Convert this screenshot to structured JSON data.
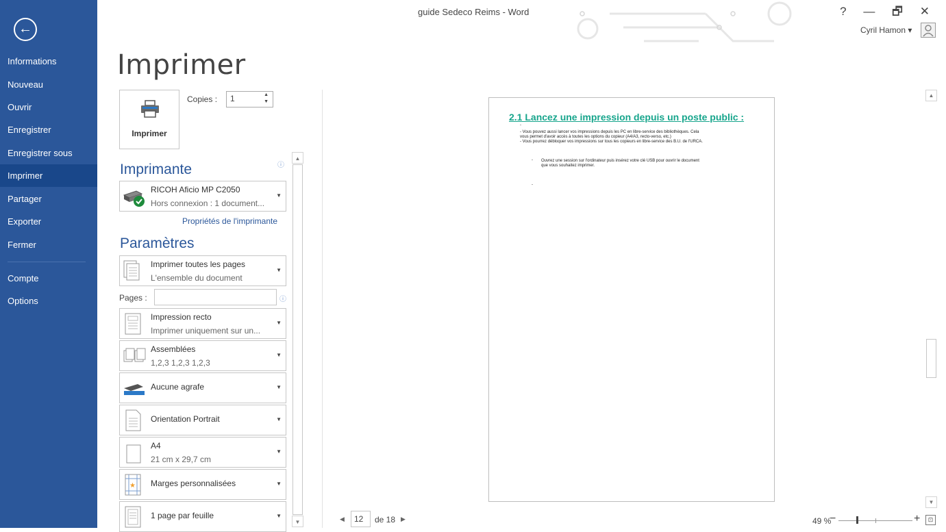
{
  "window": {
    "title": "guide Sedeco Reims - Word",
    "controls": [
      "?",
      "—",
      "🗗",
      "✕"
    ],
    "user_name": "Cyril Hamon ▾"
  },
  "sidebar": {
    "back_icon": "arrow-left-circle-icon",
    "items": [
      {
        "label": "Informations"
      },
      {
        "label": "Nouveau"
      },
      {
        "label": "Ouvrir"
      },
      {
        "label": "Enregistrer"
      },
      {
        "label": "Enregistrer sous"
      },
      {
        "label": "Imprimer"
      },
      {
        "label": "Partager"
      },
      {
        "label": "Exporter"
      },
      {
        "label": "Fermer"
      },
      {
        "label": "Compte"
      },
      {
        "label": "Options"
      }
    ],
    "active": "Imprimer",
    "color": "#2b579a",
    "active_color": "#19478a"
  },
  "print": {
    "page_title": "Imprimer",
    "print_button_label": "Imprimer",
    "copies_label": "Copies :",
    "copies_value": "1",
    "printer_section": "Imprimante",
    "printer_name": "RICOH Aficio MP C2050",
    "printer_status": "Hors connexion : 1 document...",
    "printer_properties": "Propriétés de l'imprimante",
    "settings_section": "Paramètres",
    "pages_label": "Pages :",
    "pages_value": "",
    "settings": [
      {
        "line1": "Imprimer toutes les pages",
        "line2": "L'ensemble du document",
        "icon": "document-pages-icon"
      },
      {
        "line1": "Impression recto",
        "line2": "Imprimer uniquement sur un...",
        "icon": "one-sided-icon"
      },
      {
        "line1": "Assemblées",
        "line2": "1,2,3   1,2,3   1,2,3",
        "icon": "collated-icon"
      },
      {
        "line1": "Aucune agrafe",
        "line2": "",
        "icon": "stapler-icon"
      },
      {
        "line1": "Orientation Portrait",
        "line2": "",
        "icon": "portrait-page-icon"
      },
      {
        "line1": "A4",
        "line2": "21 cm x 29,7 cm",
        "icon": "paper-size-icon"
      },
      {
        "line1": "Marges personnalisées",
        "line2": "",
        "icon": "margins-icon"
      },
      {
        "line1": "1 page par feuille",
        "line2": "",
        "icon": "pages-per-sheet-icon"
      }
    ],
    "accent_color": "#2b579a"
  },
  "preview": {
    "heading": "2.1 Lancez une impression depuis un poste public :",
    "heading_color": "#17a58c",
    "dash": "-",
    "lines": [
      "- Vous pouvez aussi lancer vos impressions depuis les PC en libre-service des bibliothèques. Cela",
      "vous permet d'avoir accès à toutes les options du copieur (A4/A3, recto-verso, etc.)",
      "- Vous pourrez débloquer vos impressions sur tous les copieurs en libre-service des B.U. de l'URCA."
    ],
    "bullet": "-",
    "bullet_lines": [
      "Ouvrez une session sur l'ordinateur puis insérez votre clé USB pour ouvrir le document",
      "que vous souhaitez imprimer."
    ]
  },
  "navigation": {
    "current_page": "12",
    "of_label": "de 18",
    "zoom_label": "49 %",
    "zoom_level": 49,
    "minus": "−",
    "plus": "+"
  }
}
